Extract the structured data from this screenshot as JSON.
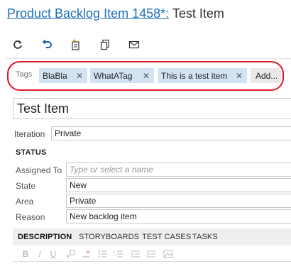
{
  "header": {
    "item_link": "Product Backlog Item 1458*:",
    "item_title": " Test Item"
  },
  "toolbar": {
    "icons": [
      "refresh-icon",
      "undo-icon",
      "copy-template-icon",
      "copy-icon",
      "email-icon"
    ]
  },
  "tags": {
    "label": "Tags",
    "items": [
      "BlaBla",
      "WhatATag",
      "This is a test item"
    ],
    "remove_glyph": "✕",
    "add_label": "Add..."
  },
  "work_item": {
    "title": "Test Item",
    "iteration_label": "Iteration",
    "iteration_value": "Private"
  },
  "status": {
    "heading": "STATUS",
    "assigned_label": "Assigned To",
    "assigned_placeholder": "Type or select a name",
    "state_label": "State",
    "state_value": "New",
    "area_label": "Area",
    "area_value": "Private",
    "reason_label": "Reason",
    "reason_value": "New backlog item"
  },
  "tabs": {
    "description": "DESCRIPTION",
    "storyboards": "STORYBOARDS",
    "test_cases": "TEST CASES",
    "tasks": "TASKS"
  },
  "editor_toolbar": {
    "bold": "B",
    "italic": "I",
    "underline": "U"
  },
  "colors": {
    "link": "#1f6fb8",
    "tag_bg": "#d4e3f3",
    "highlight": "#e0142a"
  }
}
